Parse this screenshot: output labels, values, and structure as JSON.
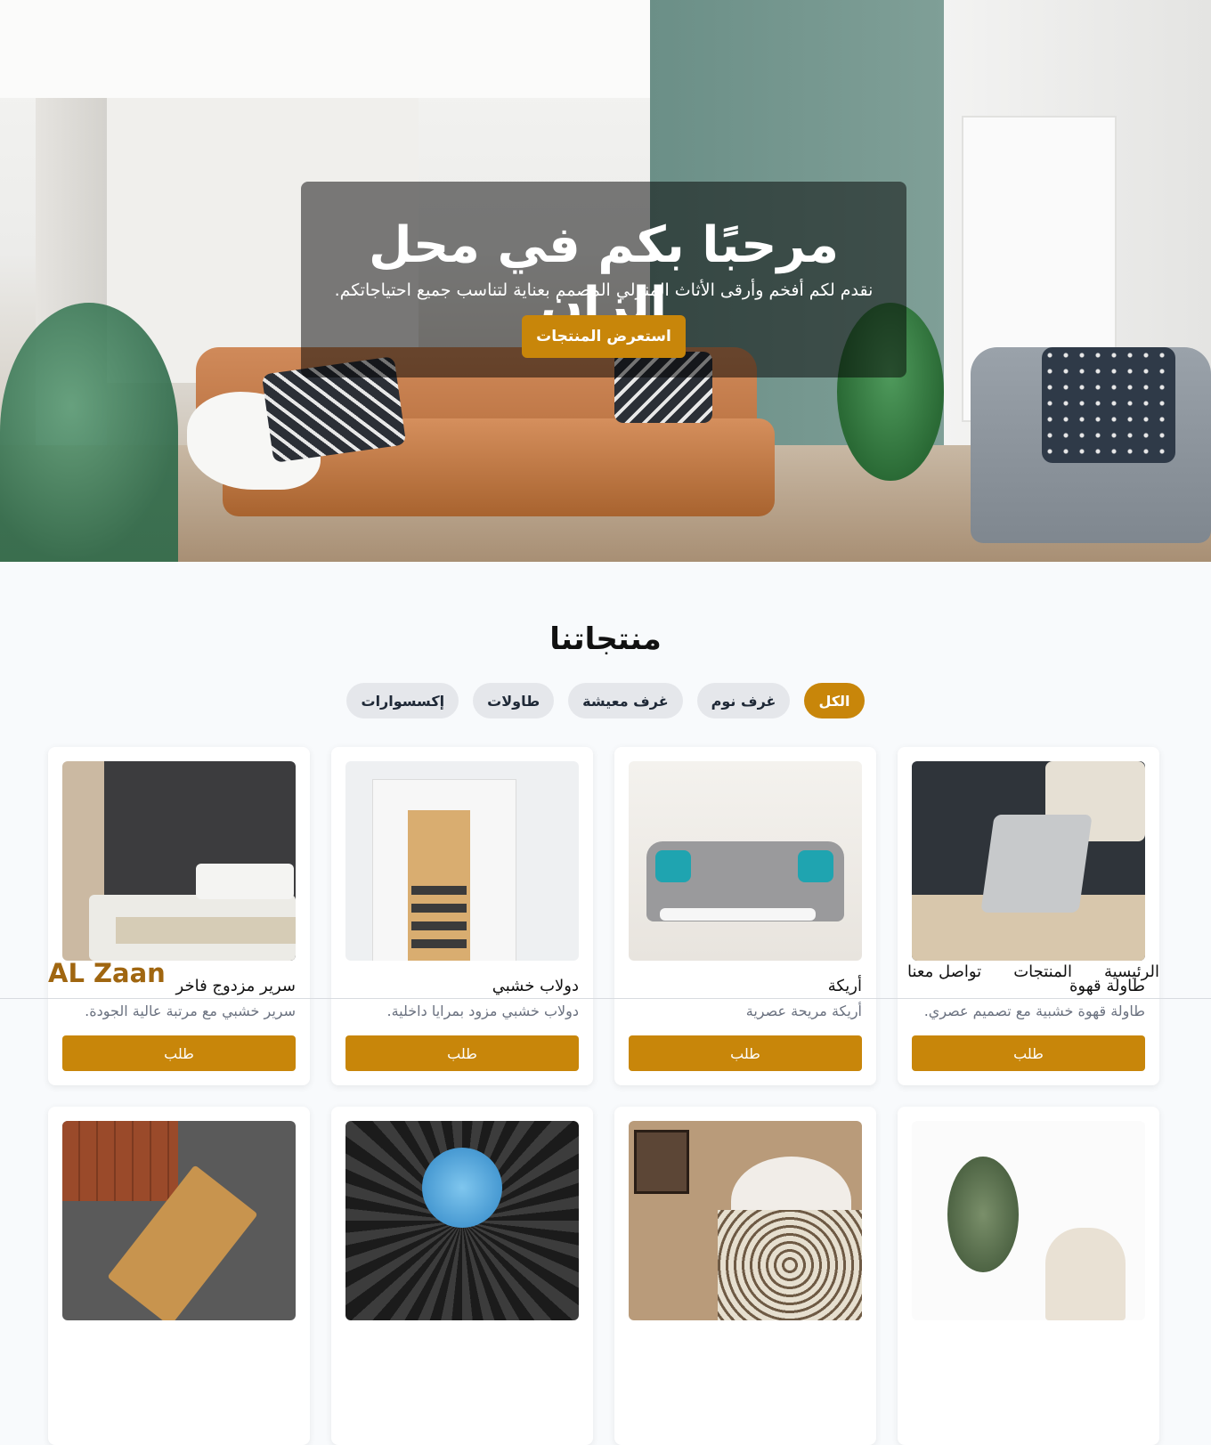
{
  "hero": {
    "title": "مرحبًا بكم في محل الزان",
    "subtitle": "نقدم لكم أفخم وأرقى الأثاث المنزلي المصمم بعناية لتناسب جميع احتياجاتكم.",
    "button": "استعرض المنتجات"
  },
  "header": {
    "logo": "AL Zaan",
    "nav": [
      "الرئيسية",
      "المنتجات",
      "تواصل معنا"
    ]
  },
  "products": {
    "title": "منتجاتنا",
    "filters": [
      "الكل",
      "غرف نوم",
      "غرف معيشة",
      "طاولات",
      "إكسسوارات"
    ],
    "active_filter": "الكل",
    "order_label": "طلب",
    "items": [
      {
        "name": "طاولة قهوة",
        "desc": "طاولة قهوة خشبية مع تصميم عصري."
      },
      {
        "name": "أريكة",
        "desc": "أريكة مريحة عصرية"
      },
      {
        "name": "دولاب خشبي",
        "desc": "دولاب خشبي مزود بمرايا داخلية."
      },
      {
        "name": "سرير مزدوج فاخر",
        "desc": "سرير خشبي مع مرتبة عالية الجودة."
      }
    ]
  },
  "colors": {
    "accent": "#c8860a",
    "logo": "#a06610",
    "chip_bg": "#e5e7eb",
    "page_bg": "#f8fafc"
  }
}
